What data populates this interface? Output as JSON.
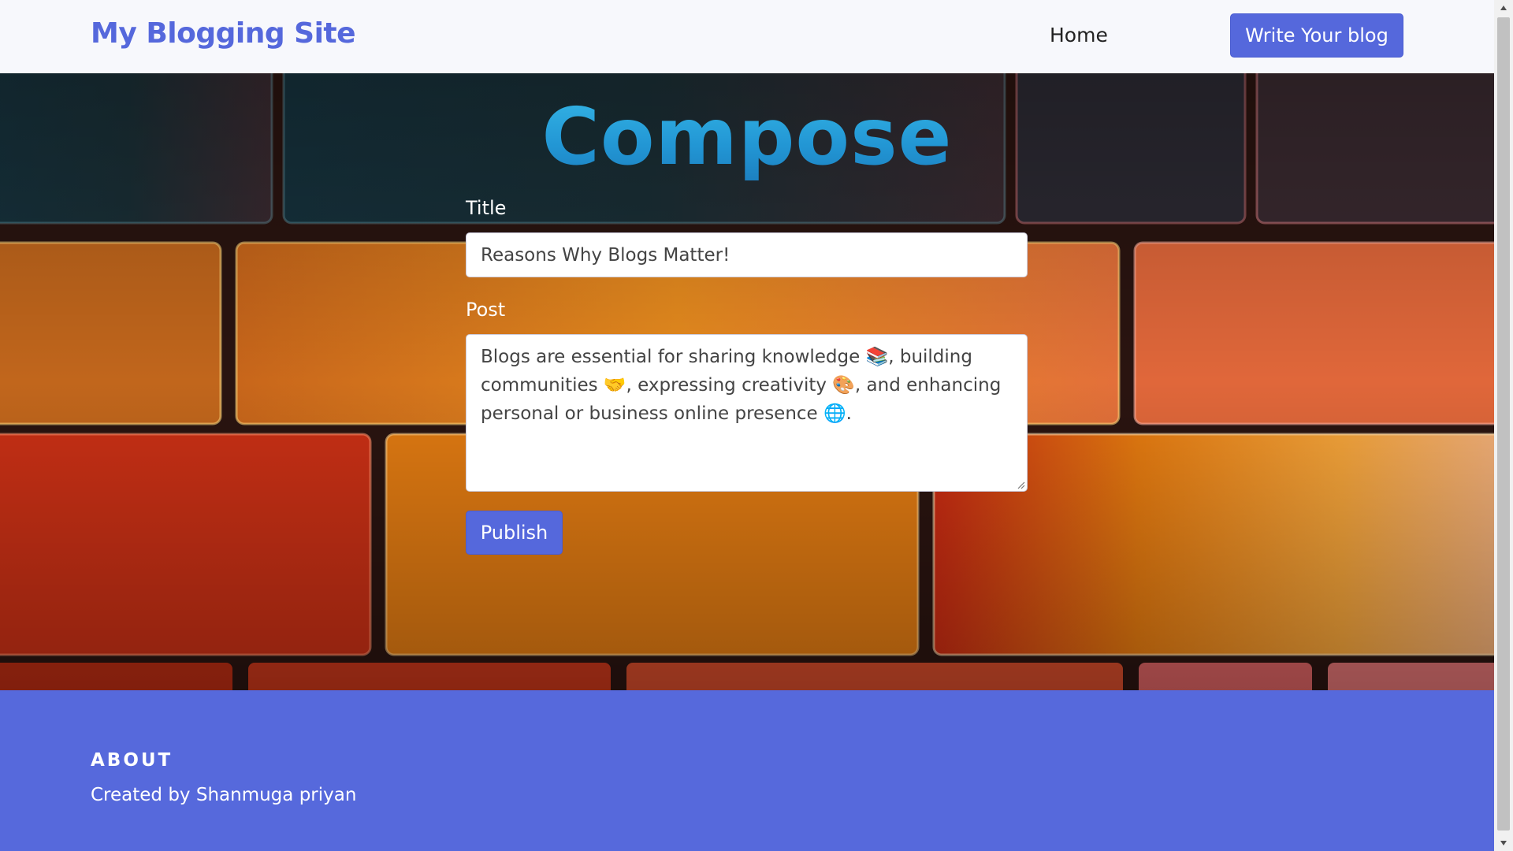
{
  "header": {
    "brand": "My Blogging Site",
    "nav_home": "Home",
    "nav_write": "Write Your blog"
  },
  "compose": {
    "heading": "Compose",
    "title_label": "Title",
    "title_value": "Reasons Why Blogs Matter!",
    "post_label": "Post",
    "post_value": "Blogs are essential for sharing knowledge 📚, building communities 🤝, expressing creativity 🎨, and enhancing personal or business online presence 🌐.",
    "publish_label": "Publish"
  },
  "footer": {
    "about_heading": "ABOUT",
    "about_text": "Created by Shanmuga priyan"
  },
  "colors": {
    "accent": "#5568dc",
    "footer_bg": "#5669dc",
    "compose_heading": "#2a9fd9"
  },
  "scrollbar": {
    "up_icon": "chevron-up-icon",
    "down_icon": "chevron-down-icon"
  }
}
